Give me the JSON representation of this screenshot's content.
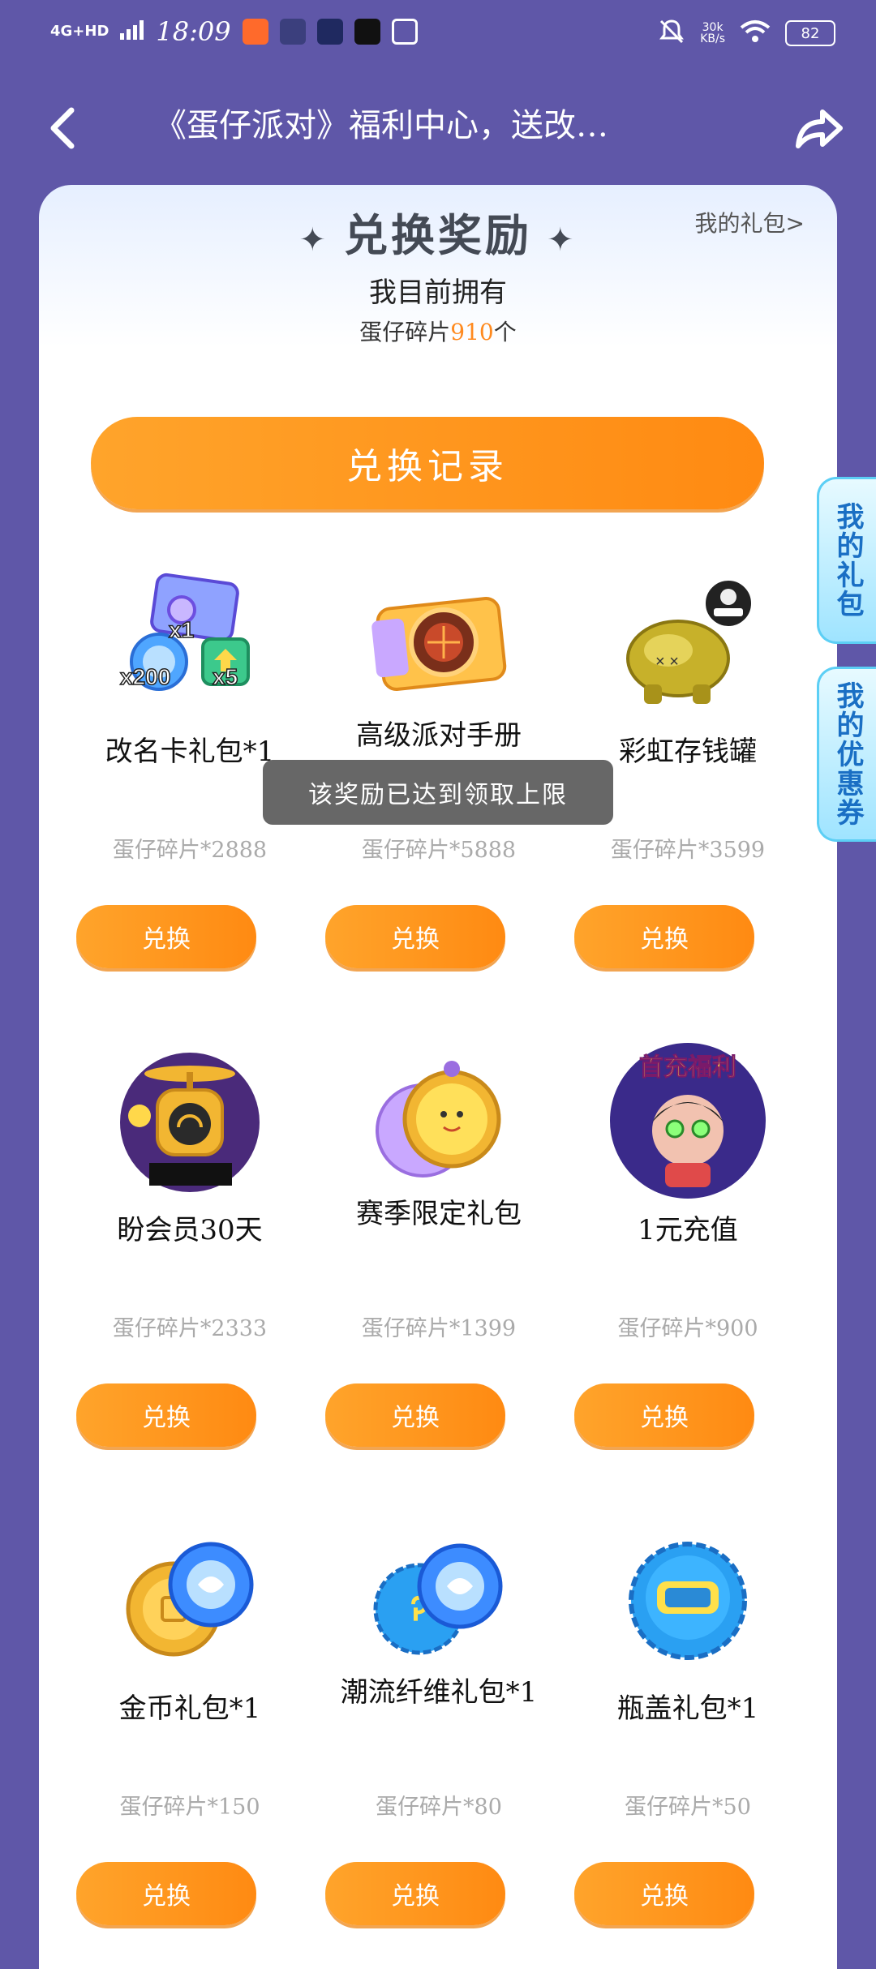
{
  "status": {
    "network": "4G+HD",
    "time": "18:09",
    "speed_value": "30k",
    "speed_unit": "KB/s",
    "battery": "82"
  },
  "topbar": {
    "title": "《蛋仔派对》福利中心，送改…"
  },
  "section": {
    "title": "兑换奖励",
    "my_gift_link": "我的礼包>",
    "own_label": "我目前拥有",
    "currency_name": "蛋仔碎片",
    "currency_amount": "910",
    "currency_unit": "个",
    "history_button": "兑换记录"
  },
  "items": [
    {
      "name": "改名卡礼包*1",
      "cost": "蛋仔碎片*2888",
      "button": "兑换",
      "icon": "rename-card-pack-icon",
      "badge_1": "x1",
      "badge_2": "x200",
      "badge_3": "x5"
    },
    {
      "name": "高级派对手册",
      "cost": "蛋仔碎片*5888",
      "button": "兑换",
      "icon": "party-handbook-icon"
    },
    {
      "name": "彩虹存钱罐",
      "cost": "蛋仔碎片*3599",
      "button": "兑换",
      "icon": "rainbow-piggy-bank-icon"
    },
    {
      "name": "盼会员30天",
      "cost": "蛋仔碎片*2333",
      "button": "兑换",
      "icon": "membership-icon"
    },
    {
      "name": "赛季限定礼包",
      "cost": "蛋仔碎片*1399",
      "button": "兑换",
      "icon": "season-pack-icon"
    },
    {
      "name": "1元充值",
      "cost": "蛋仔碎片*900",
      "button": "兑换",
      "icon": "recharge-icon",
      "banner": "首充福利"
    },
    {
      "name": "金币礼包*1",
      "cost": "蛋仔碎片*150",
      "button": "兑换",
      "icon": "coin-pack-icon"
    },
    {
      "name": "潮流纤维礼包*1",
      "cost": "蛋仔碎片*80",
      "button": "兑换",
      "icon": "fiber-pack-icon"
    },
    {
      "name": "瓶盖礼包*1",
      "cost": "蛋仔碎片*50",
      "button": "兑换",
      "icon": "bottle-cap-pack-icon"
    }
  ],
  "toast": "该奖励已达到领取上限",
  "side_tabs": {
    "gift": "我的礼包",
    "coupon": "我的优惠券"
  },
  "colors": {
    "background": "#5f57a8",
    "accent_orange": "#ff8a12",
    "side_tab_blue": "#1a6fc4"
  }
}
